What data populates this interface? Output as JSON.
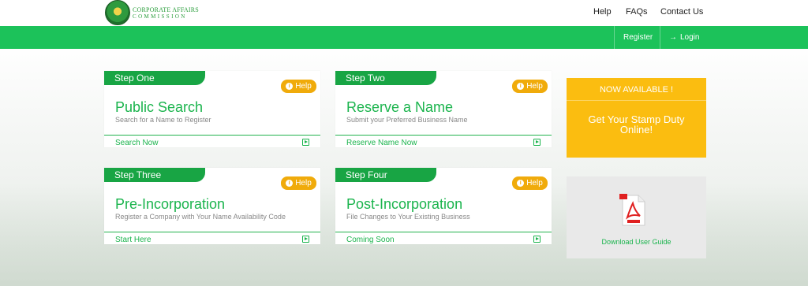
{
  "header": {
    "logo": {
      "line1": "CORPORATE AFFAIRS",
      "line2": "COMMISSION"
    },
    "nav": {
      "help": "Help",
      "faqs": "FAQs",
      "contact": "Contact Us"
    }
  },
  "greenbar": {
    "register": "Register",
    "login": "Login"
  },
  "cards": [
    {
      "step": "Step One",
      "help": "Help",
      "title": "Public Search",
      "subtitle": "Search for a Name to Register",
      "action": "Search Now"
    },
    {
      "step": "Step Two",
      "help": "Help",
      "title": "Reserve a Name",
      "subtitle": "Submit your Preferred Business Name",
      "action": "Reserve Name Now"
    },
    {
      "step": "Step Three",
      "help": "Help",
      "title": "Pre-Incorporation",
      "subtitle": "Register a Company with Your Name Availability Code",
      "action": "Start Here"
    },
    {
      "step": "Step Four",
      "help": "Help",
      "title": "Post-Incorporation",
      "subtitle": "File Changes to Your Existing Business",
      "action": "Coming Soon"
    }
  ],
  "promo": {
    "heading": "NOW AVAILABLE !",
    "line1": "Get Your Stamp Duty",
    "line2": "Online!"
  },
  "guide": {
    "label": "Download User Guide"
  },
  "colors": {
    "green": "#1cc25a",
    "dark_green": "#18a544",
    "amber": "#f0ab0b",
    "promo": "#fbbd10"
  }
}
